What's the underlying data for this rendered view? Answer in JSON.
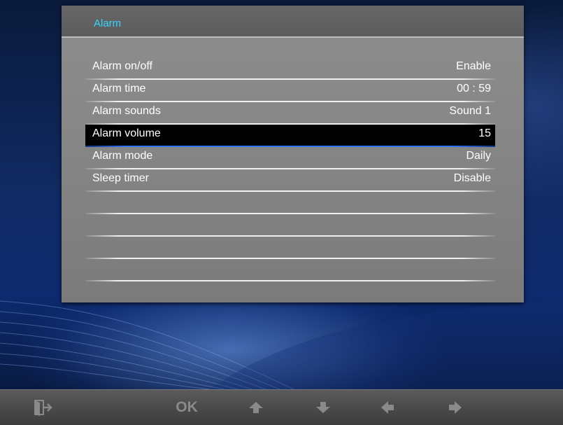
{
  "header": {
    "title": "Alarm"
  },
  "menu": {
    "items": [
      {
        "label": "Alarm on/off",
        "value": "Enable"
      },
      {
        "label": "Alarm time",
        "value": "00 : 59"
      },
      {
        "label": "Alarm sounds",
        "value": "Sound 1"
      },
      {
        "label": "Alarm volume",
        "value": "15"
      },
      {
        "label": "Alarm mode",
        "value": "Daily"
      },
      {
        "label": "Sleep timer",
        "value": "Disable"
      }
    ],
    "selected_index": 3
  },
  "bottom_bar": {
    "exit_icon": "exit-icon",
    "ok_label": "OK",
    "up_icon": "arrow-up-icon",
    "down_icon": "arrow-down-icon",
    "left_icon": "arrow-left-icon",
    "right_icon": "arrow-right-icon"
  },
  "colors": {
    "title": "#33d6ff",
    "selected_row": "#000000",
    "selected_underline": "#2f74ff",
    "panel": "#858585"
  }
}
